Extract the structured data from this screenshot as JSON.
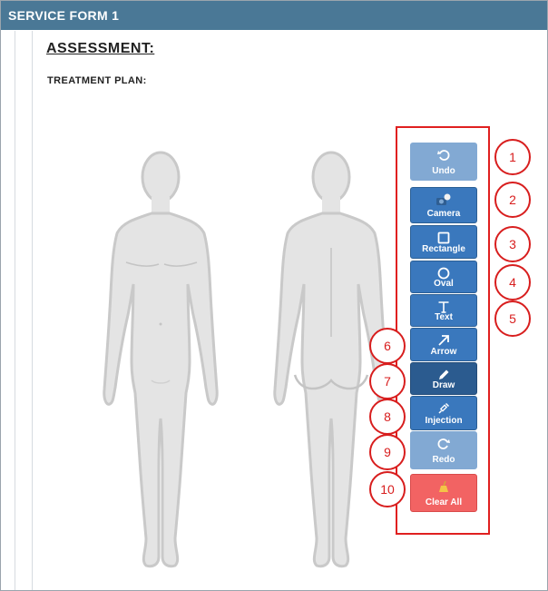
{
  "header": {
    "title": "SERVICE FORM 1"
  },
  "section": {
    "assessment": "ASSESSMENT:",
    "treatment_plan": "TREATMENT PLAN:"
  },
  "toolbar": {
    "undo": "Undo",
    "camera": "Camera",
    "rectangle": "Rectangle",
    "oval": "Oval",
    "text": "Text",
    "arrow": "Arrow",
    "draw": "Draw",
    "injection": "Injection",
    "redo": "Redo",
    "clear_all": "Clear All"
  },
  "callouts": [
    "1",
    "2",
    "3",
    "4",
    "5",
    "6",
    "7",
    "8",
    "9",
    "10"
  ],
  "colors": {
    "header_bg": "#4a7896",
    "button_blue": "#3a78bd",
    "button_disabled": "#82a9d3",
    "button_active": "#2b5b8f",
    "button_danger": "#f26363",
    "callout_red": "#d81e1e"
  }
}
